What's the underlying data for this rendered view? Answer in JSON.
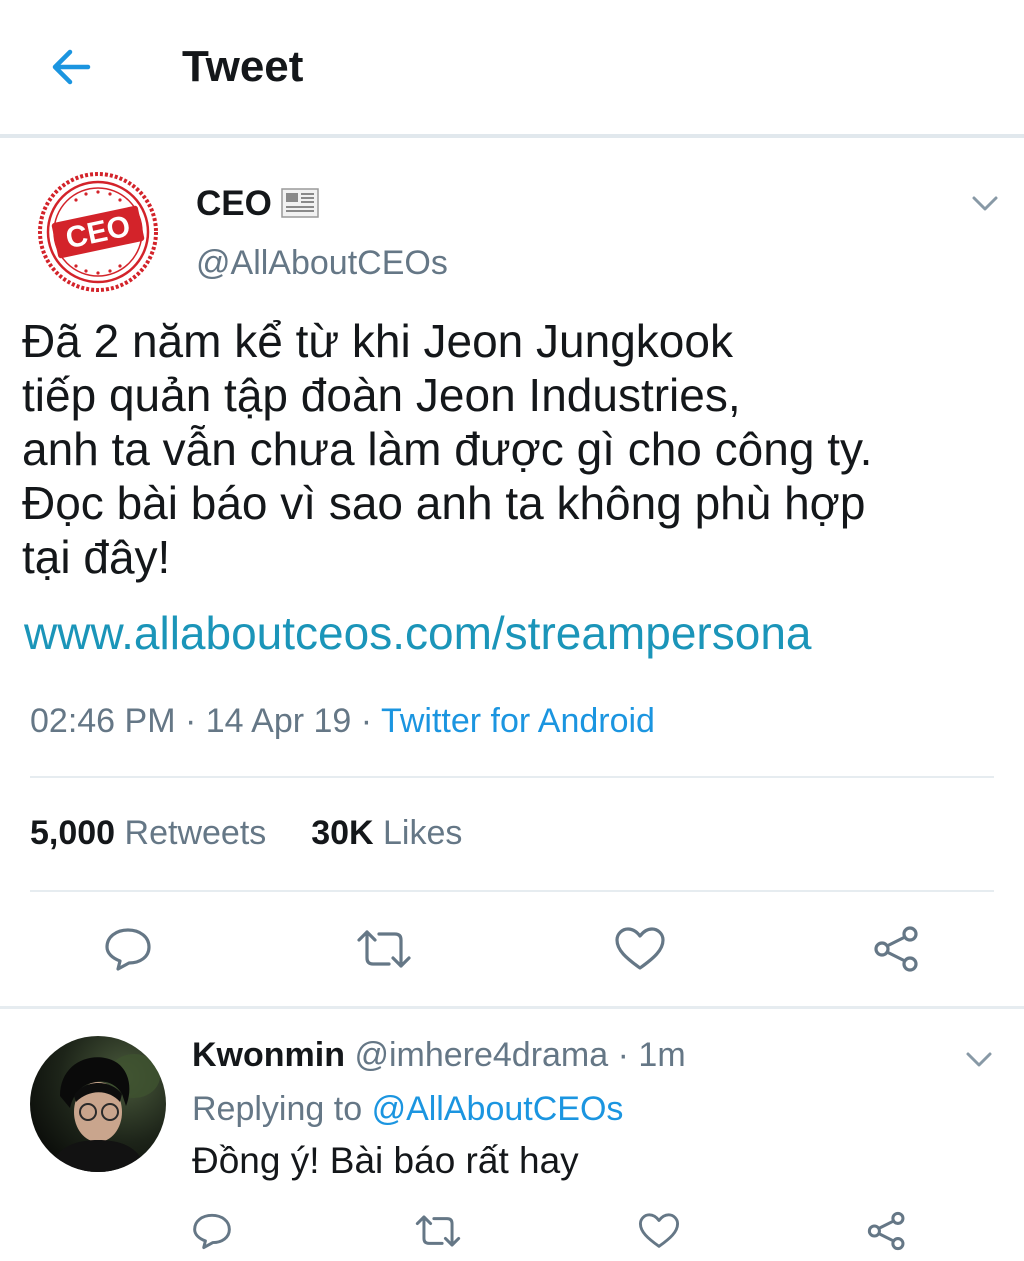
{
  "header": {
    "title": "Tweet"
  },
  "tweet": {
    "author_name": "CEO",
    "author_handle": "@AllAboutCEOs",
    "logo_text": "CEO",
    "text_lines": [
      "Đã 2 năm kể từ khi Jeon Jungkook",
      "tiếp quản tập đoàn Jeon Industries,",
      "anh ta vẫn chưa làm được gì cho công ty.",
      "Đọc bài báo vì sao anh ta không phù hợp",
      "tại đây!"
    ],
    "link": "www.allaboutceos.com/streampersona",
    "time": "02:46 PM",
    "date": "14 Apr 19",
    "separator": "·",
    "source": "Twitter for Android",
    "retweets_count": "5,000",
    "retweets_label": "Retweets",
    "likes_count": "30K",
    "likes_label": "Likes"
  },
  "reply": {
    "name": "Kwonmin",
    "handle": "@imhere4drama",
    "time": "1m",
    "replying_label": "Replying to",
    "replying_to": "@AllAboutCEOs",
    "text": "Đồng ý! Bài báo rất hay"
  },
  "icons": {
    "back": "arrow-left-icon",
    "caret": "chevron-down-icon",
    "reply": "reply-icon",
    "retweet": "retweet-icon",
    "like": "heart-icon",
    "share": "share-icon"
  },
  "colors": {
    "accent": "#1b95e0",
    "link": "#1b95b9",
    "text": "#14171a",
    "secondary": "#657786",
    "divider": "#e6ecf0",
    "logo_red": "#d3232a"
  }
}
